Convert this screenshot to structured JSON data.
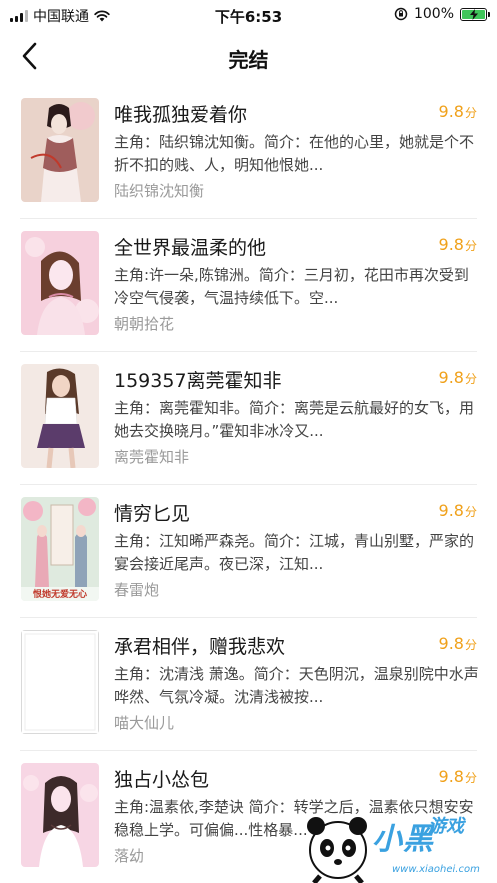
{
  "status_bar": {
    "carrier": "中国联通",
    "time": "下午6:53",
    "battery_text": "100%"
  },
  "nav": {
    "title": "完结"
  },
  "books": [
    {
      "title": "唯我孤独爱着你",
      "score": "9.8",
      "score_unit": "分",
      "desc": "主角：陆织锦沈知衡。简介：在他的心里，她就是个不折不扣的贱、人，明知他恨她...",
      "author": "陆织锦沈知衡",
      "cover": {
        "bg": "#e9d3c9",
        "accent": "#8a3a38",
        "figure": "#f3e3da"
      }
    },
    {
      "title": "全世界最温柔的他",
      "score": "9.8",
      "score_unit": "分",
      "desc": "主角:许一朵,陈锦洲。简介：三月初，花田市再次受到冷空气侵袭，气温持续低下。空...",
      "author": "朝朝拾花",
      "cover": {
        "bg": "#f6d0dd",
        "accent": "#d88aa4",
        "figure": "#fbe7ee"
      }
    },
    {
      "title": "159357离莞霍知非",
      "score": "9.8",
      "score_unit": "分",
      "desc": "主角：离莞霍知非。简介：离莞是云航最好的女飞，用她去交换晓月。”霍知非冰冷又...",
      "author": "离莞霍知非",
      "cover": {
        "bg": "#f3e9e4",
        "accent": "#5b3c6b",
        "figure": "#e7c8b8"
      }
    },
    {
      "title": "情穷匕见",
      "score": "9.8",
      "score_unit": "分",
      "desc": "主角：江知晞严森尧。简介：江城，青山别墅，严家的宴会接近尾声。夜已深，江知...",
      "author": "春雷炮",
      "cover": {
        "bg": "#dfeadf",
        "accent": "#c0392b",
        "figure": "#f4d9cf",
        "caption": "恨她无爱无心"
      }
    },
    {
      "title": "承君相伴，赠我悲欢",
      "score": "9.8",
      "score_unit": "分",
      "desc": "主角：沈清浅 萧逸。简介：天色阴沉，温泉别院中水声哗然、气氛冷凝。沈清浅被按...",
      "author": "喵大仙儿",
      "cover": {
        "bg": "#ffffff",
        "accent": "#d9d9d9",
        "figure": "#ffffff"
      }
    },
    {
      "title": "独占小怂包",
      "score": "9.8",
      "score_unit": "分",
      "desc": "主角:温素依,李楚诀 简介：转学之后，温素依只想安安稳稳上学。可偏偏...性格暴...",
      "author": "落幼",
      "cover": {
        "bg": "#f7d6e4",
        "accent": "#5a3a3a",
        "figure": "#fbe4ec"
      }
    }
  ],
  "watermark": {
    "main": "小黑",
    "sub": "游戏",
    "url": "www.xiaohei.com"
  }
}
